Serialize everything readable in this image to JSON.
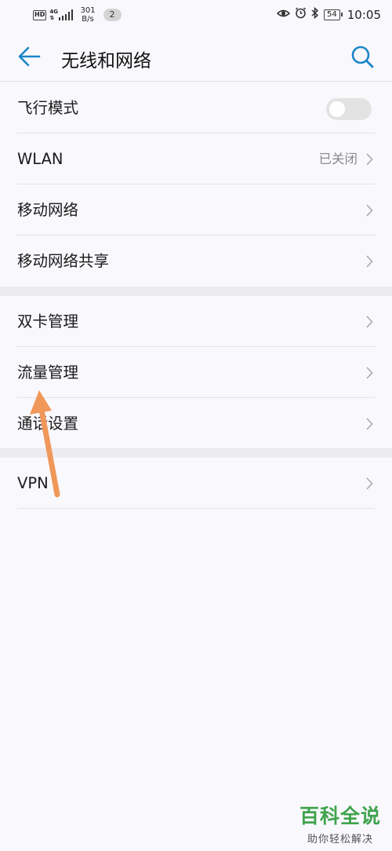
{
  "status_bar": {
    "hd": "HD",
    "network_type": "4G",
    "speed_value": "301",
    "speed_unit": "B/s",
    "notification_count": "2",
    "battery": "54",
    "time": "10:05"
  },
  "header": {
    "title": "无线和网络"
  },
  "group1": {
    "items": [
      {
        "label": "飞行模式"
      },
      {
        "label": "WLAN",
        "value": "已关闭"
      },
      {
        "label": "移动网络"
      },
      {
        "label": "移动网络共享"
      }
    ]
  },
  "group2": {
    "items": [
      {
        "label": "双卡管理"
      },
      {
        "label": "流量管理"
      },
      {
        "label": "通话设置"
      }
    ]
  },
  "group3": {
    "items": [
      {
        "label": "VPN"
      }
    ]
  },
  "airplane_mode_on": false,
  "watermark": {
    "title": "百科全说",
    "subtitle": "助你轻松解决"
  },
  "colors": {
    "accent": "#1a86c8",
    "arrow": "#f0985a",
    "watermark": "#3fa34d"
  }
}
